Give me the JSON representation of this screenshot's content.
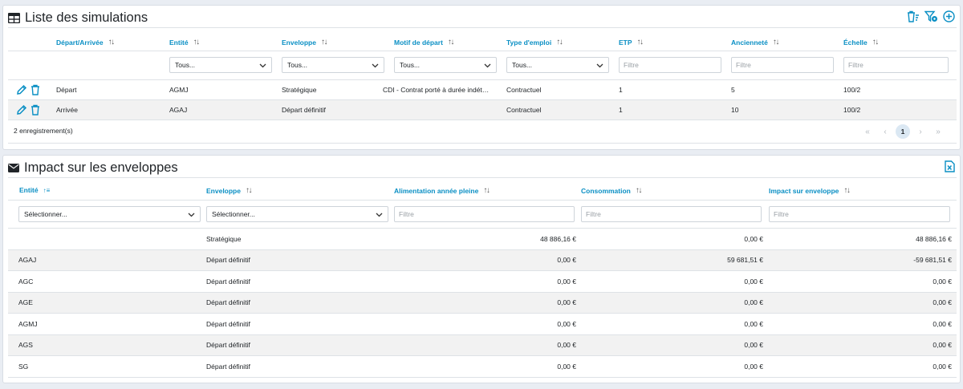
{
  "colors": {
    "accent": "#0a8fc4",
    "row_alt": "#f2f2f2"
  },
  "simulations": {
    "title": "Liste des simulations",
    "title_icon": "table-icon",
    "toolbar_icons": [
      "clear-filters-icon",
      "filter-settings-icon",
      "add-circle-icon"
    ],
    "columns": [
      "Départ/Arrivée",
      "Entité",
      "Enveloppe",
      "Motif de départ",
      "Type d'emploi",
      "ETP",
      "Ancienneté",
      "Échelle"
    ],
    "select_value": "Tous...",
    "filter_placeholder": "Filtre",
    "rows": [
      {
        "da": "Départ",
        "entite": "AGMJ",
        "enveloppe": "Stratégique",
        "motif": "CDI - Contrat porté à durée indét…",
        "type": "Contractuel",
        "etp": "1",
        "anciennete": "5",
        "echelle": "100/2"
      },
      {
        "da": "Arrivée",
        "entite": "AGAJ",
        "enveloppe": "Départ définitif",
        "motif": "",
        "type": "Contractuel",
        "etp": "1",
        "anciennete": "10",
        "echelle": "100/2"
      }
    ],
    "record_count": "2 enregistrement(s)",
    "pager": {
      "first": "«",
      "prev": "‹",
      "current": "1",
      "next": "›",
      "last": "»"
    }
  },
  "impact": {
    "title": "Impact sur les enveloppes",
    "title_icon": "envelope-icon",
    "toolbar_icons": [
      "excel-export-icon"
    ],
    "columns": [
      "Entité",
      "Enveloppe",
      "Alimentation année pleine",
      "Consommation",
      "Impact sur enveloppe"
    ],
    "select_value": "Sélectionner...",
    "filter_placeholder": "Filtre",
    "rows": [
      {
        "entite": "",
        "enveloppe": "Stratégique",
        "alimentation": "48 886,16 €",
        "consommation": "0,00 €",
        "impact": "48 886,16 €"
      },
      {
        "entite": "AGAJ",
        "enveloppe": "Départ définitif",
        "alimentation": "0,00 €",
        "consommation": "59 681,51 €",
        "impact": "-59 681,51 €"
      },
      {
        "entite": "AGC",
        "enveloppe": "Départ définitif",
        "alimentation": "0,00 €",
        "consommation": "0,00 €",
        "impact": "0,00 €"
      },
      {
        "entite": "AGE",
        "enveloppe": "Départ définitif",
        "alimentation": "0,00 €",
        "consommation": "0,00 €",
        "impact": "0,00 €"
      },
      {
        "entite": "AGMJ",
        "enveloppe": "Départ définitif",
        "alimentation": "0,00 €",
        "consommation": "0,00 €",
        "impact": "0,00 €"
      },
      {
        "entite": "AGS",
        "enveloppe": "Départ définitif",
        "alimentation": "0,00 €",
        "consommation": "0,00 €",
        "impact": "0,00 €"
      },
      {
        "entite": "SG",
        "enveloppe": "Départ définitif",
        "alimentation": "0,00 €",
        "consommation": "0,00 €",
        "impact": "0,00 €"
      }
    ]
  }
}
